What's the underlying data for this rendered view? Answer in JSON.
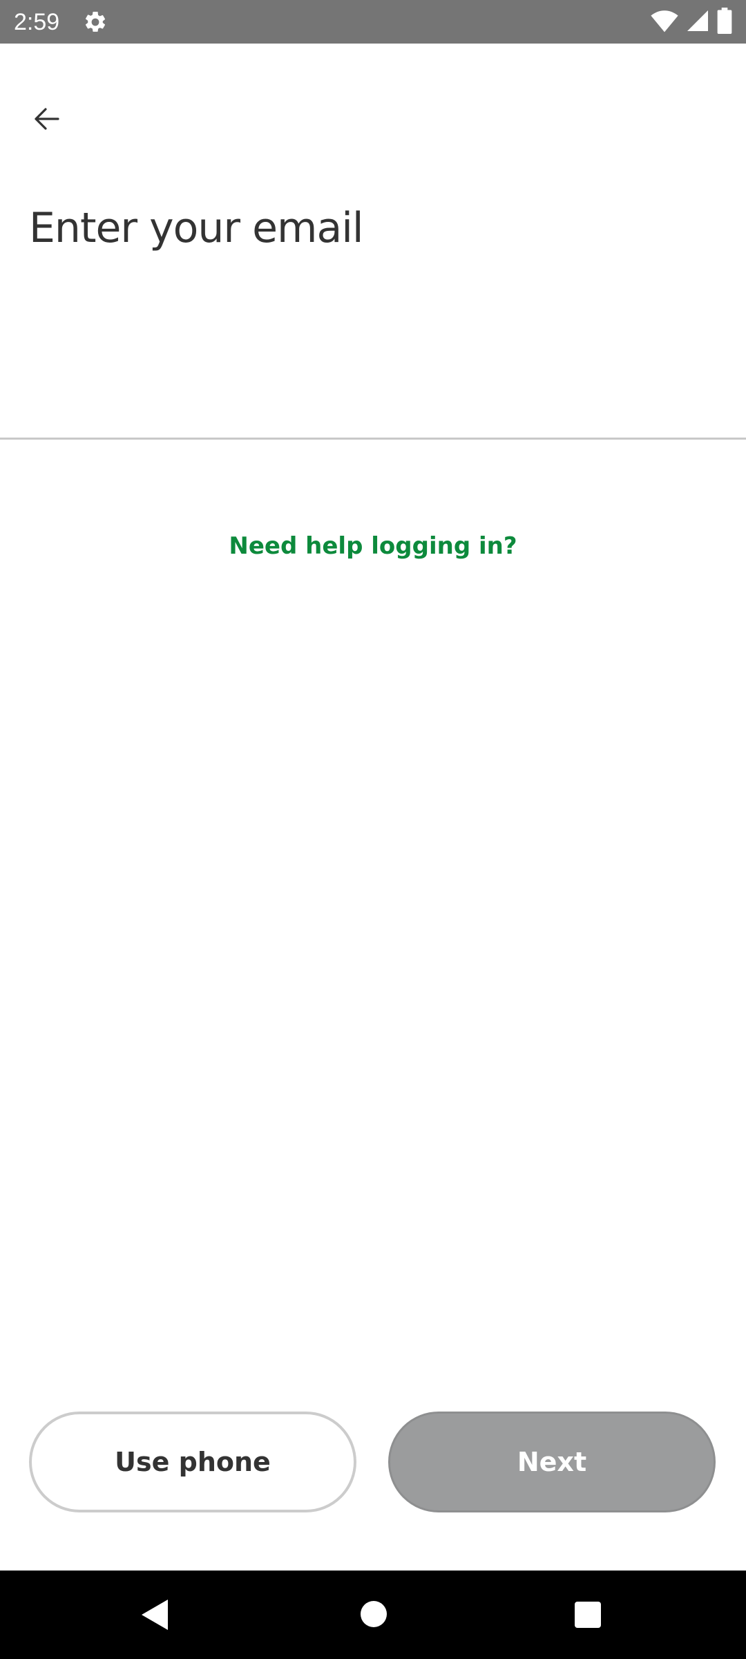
{
  "status_bar": {
    "time": "2:59",
    "icons": [
      "gear-icon",
      "wifi-icon",
      "cell-signal-icon",
      "battery-icon"
    ],
    "background": "#757575"
  },
  "header": {
    "back_icon": "arrow-left-icon"
  },
  "main": {
    "title": "Enter your email",
    "email_value": "",
    "help_link": "Need help logging in?"
  },
  "footer": {
    "use_phone_label": "Use phone",
    "next_label": "Next"
  },
  "colors": {
    "accent_green": "#0d8a3c",
    "disabled_button": "#9b9c9d",
    "title_text": "#333333"
  },
  "nav_bar": {
    "icons": [
      "nav-back-icon",
      "nav-home-icon",
      "nav-recents-icon"
    ]
  }
}
